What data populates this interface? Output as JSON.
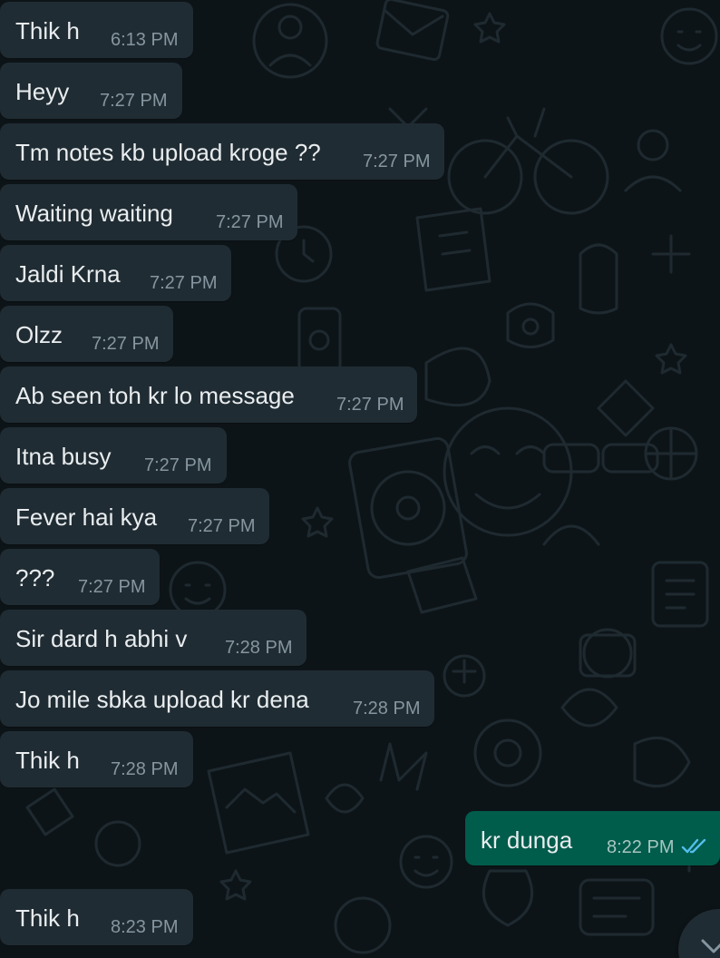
{
  "colors": {
    "background": "#0d1418",
    "incoming_bubble": "#202c33",
    "outgoing_bubble": "#005c4b",
    "text": "#e9edef",
    "timestamp": "#8696a0",
    "read_ticks": "#53bdeb"
  },
  "messages": [
    {
      "direction": "in",
      "text": "Thik h",
      "time": "6:13 PM"
    },
    {
      "direction": "in",
      "text": "Heyy",
      "time": "7:27 PM"
    },
    {
      "direction": "in",
      "text": "Tm notes kb upload kroge ??",
      "time": "7:27 PM"
    },
    {
      "direction": "in",
      "text": "Waiting waiting",
      "time": "7:27 PM"
    },
    {
      "direction": "in",
      "text": "Jaldi Krna",
      "time": "7:27 PM"
    },
    {
      "direction": "in",
      "text": "Olzz",
      "time": "7:27 PM"
    },
    {
      "direction": "in",
      "text": "Ab seen toh kr lo message",
      "time": "7:27 PM"
    },
    {
      "direction": "in",
      "text": "Itna busy",
      "time": "7:27 PM"
    },
    {
      "direction": "in",
      "text": "Fever hai kya",
      "time": "7:27 PM"
    },
    {
      "direction": "in",
      "text": "???",
      "time": "7:27 PM"
    },
    {
      "direction": "in",
      "text": "Sir dard h abhi v",
      "time": "7:28 PM"
    },
    {
      "direction": "in",
      "text": "Jo mile sbka upload kr dena",
      "time": "7:28 PM"
    },
    {
      "direction": "in",
      "text": "Thik h",
      "time": "7:28 PM"
    },
    {
      "direction": "out",
      "text": "kr dunga",
      "time": "8:22 PM",
      "status": "read"
    },
    {
      "direction": "in",
      "text": "Thik h",
      "time": "8:23 PM"
    }
  ],
  "scroll_button": {
    "icon": "chevron-down-icon"
  }
}
